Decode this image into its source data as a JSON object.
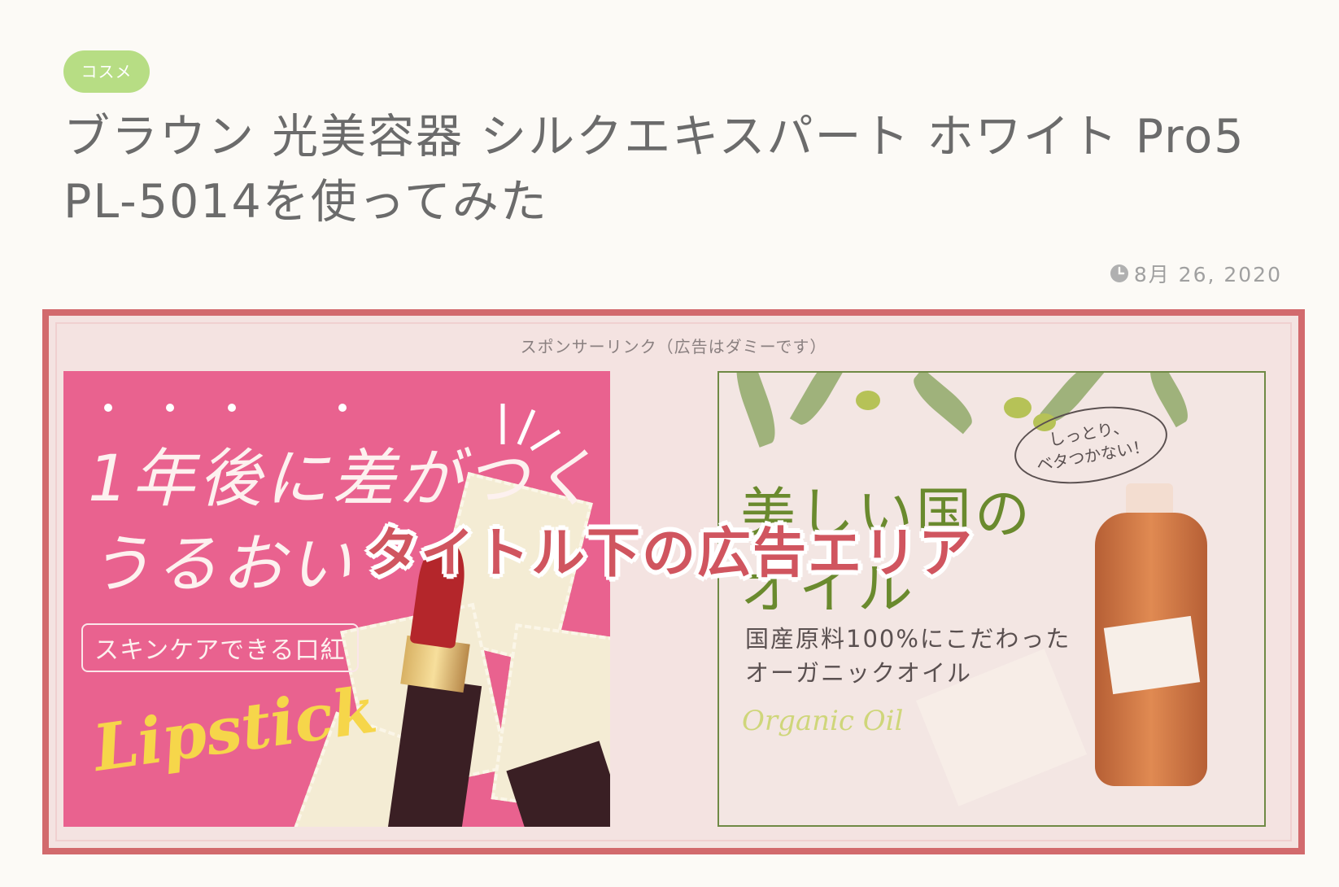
{
  "post": {
    "category": "コスメ",
    "title": "ブラウン 光美容器 シルクエキスパート ホワイト Pro5 PL-5014を使ってみた",
    "date": "8月 26, 2020"
  },
  "ad_area": {
    "sponsor_label": "スポンサーリンク（広告はダミーです）",
    "overlay_caption": "タイトル下の広告エリア",
    "accent_color": "#d26a6d",
    "left_ad": {
      "headline_1": "1年後に差がつく",
      "headline_2": "うるおい",
      "boxed_text": "スキンケアできる口紅",
      "script_text": "Lipstick"
    },
    "right_ad": {
      "headline_1": "美しい国の",
      "headline_2": "オイル",
      "subtext_1": "国産原料100%にこだわった",
      "subtext_2": "オーガニックオイル",
      "script_text": "Organic Oil",
      "bubble_text_1": "しっとり、",
      "bubble_text_2": "ベタつかない！"
    }
  },
  "icons": {
    "clock": "clock-icon"
  }
}
